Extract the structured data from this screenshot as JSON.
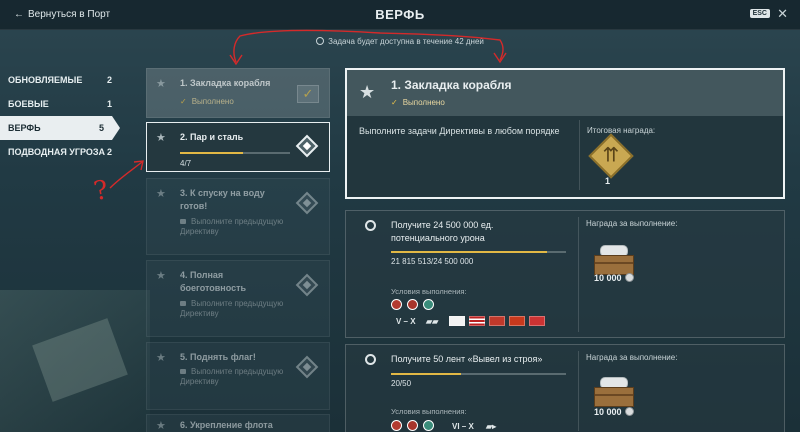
{
  "topbar": {
    "back_label": "Вернуться в Порт",
    "title": "ВЕРФЬ",
    "esc_label": "ESC"
  },
  "timer_text": "Задача будет доступна в течение 42 дней",
  "nav": [
    {
      "label": "ОБНОВЛЯЕМЫЕ",
      "count": "2"
    },
    {
      "label": "БОЕВЫЕ",
      "count": "1"
    },
    {
      "label": "ВЕРФЬ",
      "count": "5"
    },
    {
      "label": "ПОДВОДНАЯ УГРОЗА",
      "count": "2"
    }
  ],
  "directives": [
    {
      "name": "1. Закладка корабля",
      "status": "Выполнено"
    },
    {
      "name": "2. Пар и сталь",
      "progress": "4/7",
      "progress_fraction": 0.571
    },
    {
      "name": "3. К спуску на воду готов!",
      "lock_text": "Выполните предыдущую Директиву"
    },
    {
      "name": "4. Полная боеготовность",
      "lock_text": "Выполните предыдущую Директиву"
    },
    {
      "name": "5. Поднять флаг!",
      "lock_text": "Выполните предыдущую Директиву"
    },
    {
      "name": "6. Укрепление флота"
    }
  ],
  "detail": {
    "title": "1. Закладка корабля",
    "status": "Выполнено",
    "description": "Выполните задачи Директивы в любом порядке",
    "reward_label": "Итоговая награда:",
    "reward_count": "1"
  },
  "tasks": [
    {
      "name": "Получите 24 500 000 ед. потенциального урона",
      "progress": "21 815 513/24 500 000",
      "progress_fraction": 0.89,
      "conditions_label": "Условия выполнения:",
      "tiers": "V – X",
      "reward_label": "Награда за выполнение:",
      "credits": "10 000"
    },
    {
      "name": "Получите 50 лент «Вывел из строя»",
      "progress": "20/50",
      "progress_fraction": 0.4,
      "conditions_label": "Условия выполнения:",
      "tiers": "VI – X",
      "reward_label": "Награда за выполнение:",
      "credits": "10 000"
    }
  ],
  "colors": {
    "accent_gold": "#e2b845",
    "annotation_red": "#d42a2a"
  }
}
